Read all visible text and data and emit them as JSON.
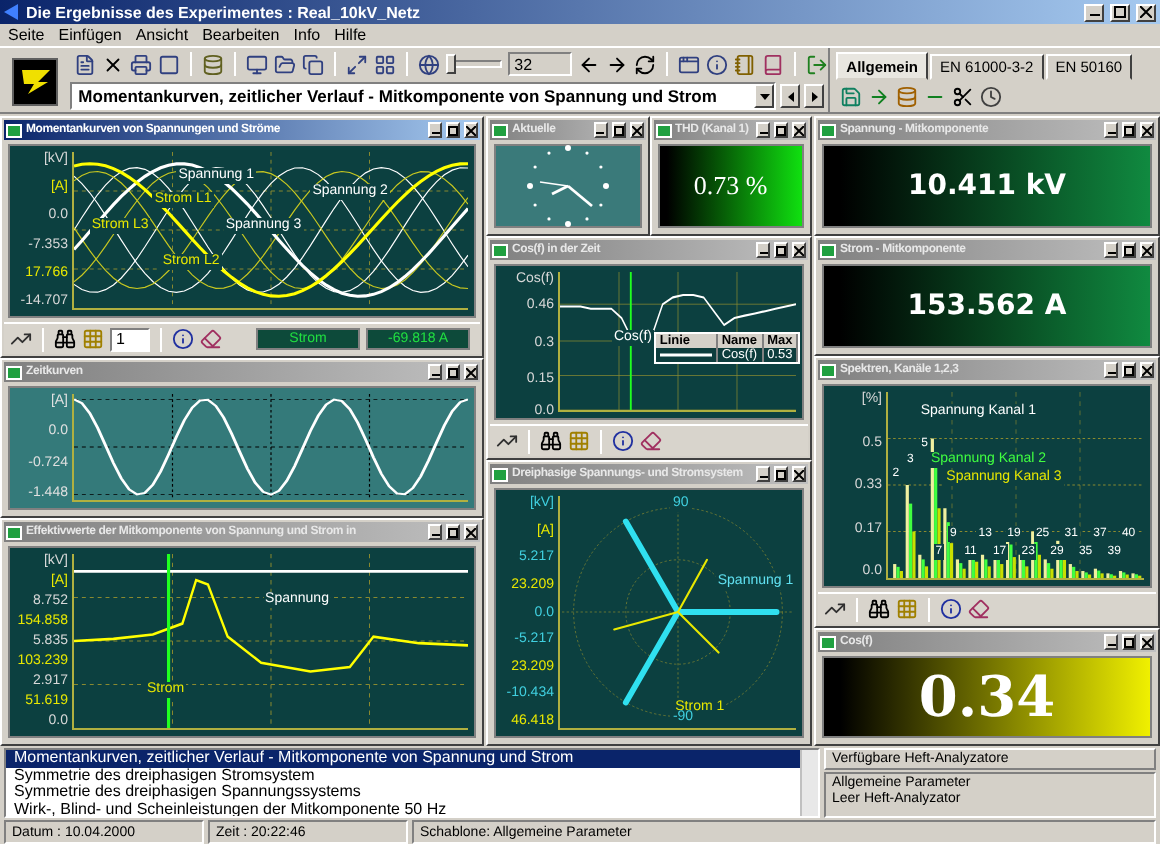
{
  "window": {
    "title": "Die Ergebnisse des Experimentes : Real_10kV_Netz"
  },
  "menu": [
    "Seite",
    "Einfügen",
    "Ansicht",
    "Bearbeiten",
    "Info",
    "Hilfe"
  ],
  "toolbar": {
    "zoom_slider": {
      "level": 0.05
    },
    "spin_value": "32"
  },
  "view_select": {
    "value": "Momentankurven, zeitlicher Verlauf - Mitkomponente von Spannung und Strom"
  },
  "tabs": [
    {
      "label": "Allgemein",
      "selected": true
    },
    {
      "label": "EN 61000-3-2",
      "selected": false
    },
    {
      "label": "EN 50160",
      "selected": false
    }
  ],
  "columns": [
    {
      "rows": [
        [
          {
            "kind": "wave",
            "title": "Momentankurven von Spannungen und Ströme",
            "active": true,
            "has_toolbar": true,
            "spin_value": "1",
            "readouts": [
              "Strom",
              "-69.818 A"
            ],
            "axis": [
              {
                "text": "[kV]",
                "color": "#d8d8d8"
              },
              {
                "text": "[A]",
                "color": "#e8e800"
              },
              {
                "text": "0.0",
                "color": "#d8d8d8"
              },
              {
                "text": "-7.353",
                "color": "#d8d8d8"
              },
              {
                "text": "17.766",
                "color": "#e8e800"
              },
              {
                "text": "-14.707",
                "color": "#d8d8d8"
              }
            ],
            "annotations": [
              "Spannung 1",
              "Strom L1",
              "Spannung 2",
              "Strom L3",
              "Spannung 3",
              "Strom L2"
            ]
          }
        ],
        [
          {
            "kind": "sine",
            "title": "Zeitkurven",
            "active": false,
            "has_toolbar": false,
            "axis": [
              {
                "text": "[A]",
                "color": "#e0e0e0"
              },
              {
                "text": "0.0",
                "color": "#e0e0e0"
              },
              {
                "text": "-0.724",
                "color": "#e0e0e0"
              },
              {
                "text": "-1.448",
                "color": "#e0e0e0"
              }
            ]
          }
        ],
        [
          {
            "kind": "rms",
            "title": "Effektivwerte der Mitkomponente von Spannung und Strom in",
            "active": false,
            "has_toolbar": false,
            "axis": [
              {
                "text": "[kV]",
                "color": "#d8d8d8"
              },
              {
                "text": "[A]",
                "color": "#e8e800"
              },
              {
                "text": "8.752",
                "color": "#d8d8d8"
              },
              {
                "text": "154.858",
                "color": "#e8e800"
              },
              {
                "text": "5.835",
                "color": "#d8d8d8"
              },
              {
                "text": "103.239",
                "color": "#e8e800"
              },
              {
                "text": "2.917",
                "color": "#d8d8d8"
              },
              {
                "text": "51.619",
                "color": "#e8e800"
              },
              {
                "text": "0.0",
                "color": "#d8d8d8"
              }
            ],
            "annotations": [
              "Spannung",
              "Strom"
            ]
          }
        ]
      ]
    },
    {
      "rows": [
        [
          {
            "kind": "clock",
            "title": "Aktuelle",
            "active": false,
            "has_toolbar": false
          },
          {
            "kind": "meter_serif",
            "title": "THD (Kanal 1)",
            "active": false,
            "has_toolbar": false,
            "value": "0.73 %",
            "color": "#10e010"
          }
        ],
        [
          {
            "kind": "cos",
            "title": "Cos(f) in der Zeit",
            "active": false,
            "has_toolbar": true,
            "chart_data": {
              "type": "line",
              "ylabel": "Cos(f)",
              "ylim": [
                0,
                0.6
              ],
              "grid": true,
              "yticks": [
                {
                  "value": 0.46,
                  "label": "0.46"
                },
                {
                  "value": 0.3,
                  "label": "0.3"
                },
                {
                  "value": 0.15,
                  "label": "0.15"
                },
                {
                  "value": 0,
                  "label": "0.0"
                }
              ],
              "series": [
                {
                  "name": "Cos(f)",
                  "color": "#ffffff",
                  "values": [
                    0.45,
                    0.45,
                    0.45,
                    0.44,
                    0.44,
                    0.44,
                    0.4,
                    0.31,
                    0.3,
                    0.33,
                    0.46,
                    0.49,
                    0.5,
                    0.5,
                    0.49,
                    0.43,
                    0.37,
                    0.4,
                    0.41,
                    0.42,
                    0.43,
                    0.44,
                    0.45,
                    0.46
                  ]
                }
              ]
            },
            "legend": {
              "columns": [
                "Linie",
                "Name",
                "Max"
              ],
              "max": "0.53"
            }
          }
        ],
        [
          {
            "kind": "phasor",
            "title": "Dreiphasige Spannungs- und Stromsystem",
            "active": false,
            "has_toolbar": false,
            "axis": [
              {
                "text": "[kV]",
                "color": "#40d0e0"
              },
              {
                "text": "[A]",
                "color": "#e8e800"
              },
              {
                "text": "5.217",
                "color": "#40d0e0"
              },
              {
                "text": "23.209",
                "color": "#e8e800"
              },
              {
                "text": "0.0",
                "color": "#40d0e0"
              },
              {
                "text": "-5.217",
                "color": "#40d0e0"
              },
              {
                "text": "23.209",
                "color": "#e8e800"
              },
              {
                "text": "-10.434",
                "color": "#40d0e0"
              },
              {
                "text": "46.418",
                "color": "#e8e800"
              }
            ],
            "angles": [
              "90",
              "-90"
            ],
            "annotations": [
              "Spannung 1",
              "Strom 1"
            ]
          }
        ]
      ]
    },
    {
      "rows": [
        [
          {
            "kind": "meter",
            "title": "Spannung - Mitkomponente",
            "active": false,
            "has_toolbar": false,
            "value": "10.411 kV",
            "color": "#108a40"
          }
        ],
        [
          {
            "kind": "meter",
            "title": "Strom - Mitkomponente",
            "active": false,
            "has_toolbar": false,
            "value": "153.562 A",
            "color": "#108a40"
          }
        ],
        [
          {
            "kind": "spectrum",
            "title": "Spektren, Kanäle 1,2,3",
            "active": false,
            "has_toolbar": true,
            "axis": [
              {
                "text": "[%]",
                "color": "#d8d8d8"
              },
              {
                "text": "0.5",
                "color": "#d8d8d8"
              },
              {
                "text": "0.33",
                "color": "#d8d8d8"
              },
              {
                "text": "0.17",
                "color": "#d8d8d8"
              },
              {
                "text": "0.0",
                "color": "#d8d8d8"
              }
            ],
            "annotations": [
              "Spannung Kanal 1",
              "Spannung Kanal 2",
              "Spannung Kanal 3"
            ],
            "bar_labels": [
              "2",
              "3",
              "5",
              "7",
              "9",
              "11",
              "13",
              "17",
              "19",
              "23",
              "25",
              "29",
              "31",
              "35",
              "37",
              "39",
              "40"
            ]
          }
        ],
        [
          {
            "kind": "meter_large",
            "title": "Cos(f)",
            "active": false,
            "has_toolbar": false,
            "value": "0.34",
            "color": "#f0f000"
          }
        ]
      ]
    }
  ],
  "analyses": {
    "items": [
      {
        "label": "Momentankurven, zeitlicher Verlauf - Mitkomponente von Spannung und Strom",
        "selected": true
      },
      {
        "label": "Symmetrie des dreiphasigen Stromsystem",
        "selected": false
      },
      {
        "label": "Symmetrie des dreiphasigen Spannungssystems",
        "selected": false
      },
      {
        "label": "Wirk-, Blind- und Scheinleistungen der Mitkomponente 50 Hz",
        "selected": false
      }
    ]
  },
  "analyzers": {
    "header": "Verfügbare Heft-Analyzatore",
    "items": [
      "Allgemeine Parameter",
      "Leer Heft-Analyzator"
    ]
  },
  "status_bar": [
    "Datum : 10.04.2000",
    "Zeit : 20:22:46",
    "Schablone: Allgemeine Parameter"
  ]
}
